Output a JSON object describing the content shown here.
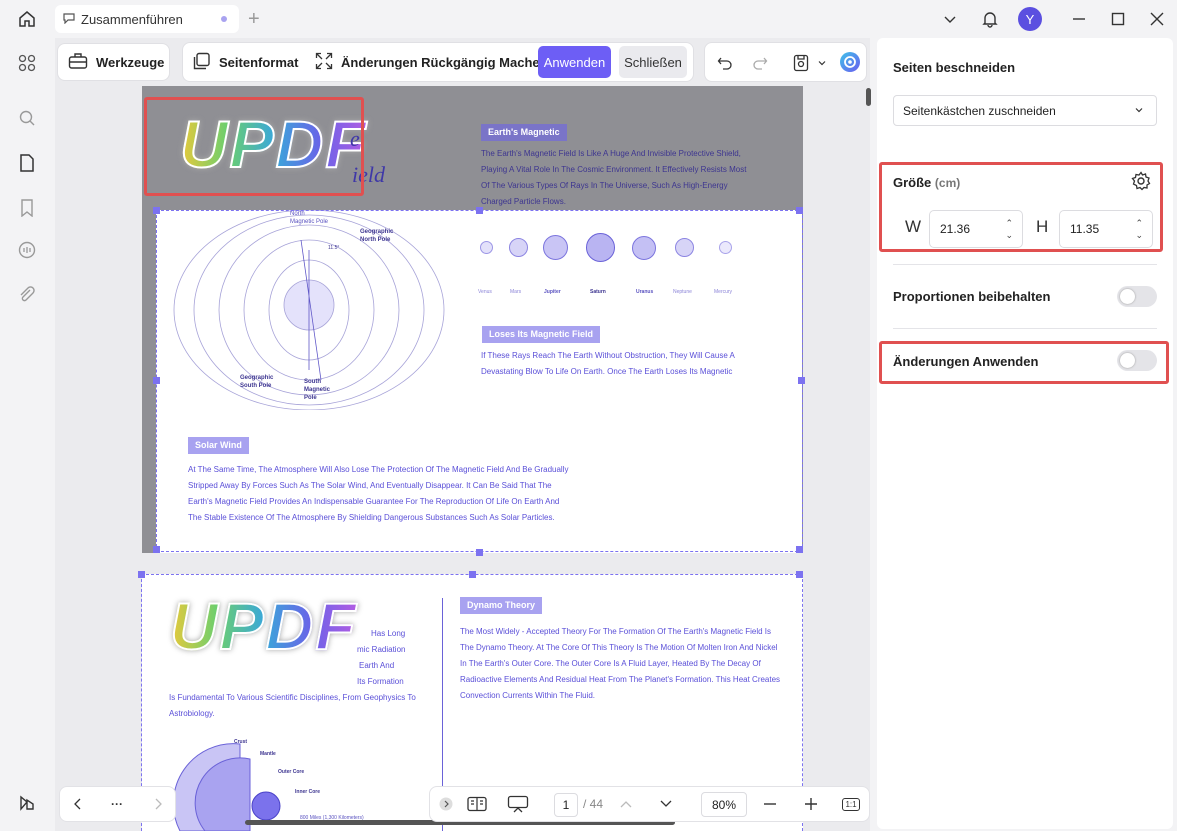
{
  "tab": {
    "title": "Zusammenführen"
  },
  "user": {
    "avatar_letter": "Y"
  },
  "toolbar": {
    "tools_label": "Werkzeuge",
    "page_format_label": "Seitenformat",
    "undo_changes_label": "Änderungen Rückgängig Machen",
    "apply_label": "Anwenden",
    "close_label": "Schließen"
  },
  "panel": {
    "title": "Seiten beschneiden",
    "crop_select_value": "Seitenkästchen zuschneiden",
    "size_label": "Größe",
    "size_unit": "(cm)",
    "w_label": "W",
    "w_value": "21.36",
    "h_label": "H",
    "h_value": "11.35",
    "keep_proportions_label": "Proportionen beibehalten",
    "keep_proportions_on": false,
    "apply_changes_label": "Änderungen Anwenden",
    "apply_changes_on": false
  },
  "bottom": {
    "more_label": "···",
    "page_current": "1",
    "page_total": "/ 44",
    "zoom": "80%",
    "fit_label": "1:1"
  },
  "doc": {
    "logo_text": "UPDF",
    "page1": {
      "title_partial_1": "e",
      "title_partial_2": "ield",
      "section1_label": "Earth's Magnetic",
      "section1_text": [
        "The Earth's Magnetic Field Is Like A Huge And Invisible Protective Shield,",
        "Playing A Vital Role In The Cosmic Environment. It Effectively Resists Most",
        "Of The Various Types Of Rays In The Universe, Such As High-Energy",
        "Charged Particle Flows."
      ],
      "diagram_labels": {
        "north_magnetic": "North Magnetic Pole",
        "geo_north": "Geographic North Pole",
        "geo_south": "Geographic South Pole",
        "south_magnetic": "South Magnetic Pole",
        "angle": "11.5°"
      },
      "planets": [
        "Venus",
        "Mars",
        "Jupiter",
        "Saturn",
        "Uranus",
        "Neptune",
        "Mercury"
      ],
      "section2_label": "Loses Its Magnetic Field",
      "section2_text": [
        "If These Rays Reach The Earth Without Obstruction, They Will Cause A",
        "Devastating Blow To Life On Earth. Once The Earth Loses Its Magnetic"
      ],
      "section3_label": "Solar Wind",
      "section3_text": [
        "At The Same Time, The Atmosphere Will Also Lose The Protection Of The Magnetic Field And Be Gradually",
        "Stripped Away By Forces Such As The Solar Wind, And Eventually Disappear. It Can Be Said That The",
        "Earth's Magnetic Field Provides An Indispensable Guarantee For The Reproduction Of Life On Earth And",
        "The Stable Existence Of The Atmosphere By Shielding Dangerous Substances Such As Solar Particles."
      ]
    },
    "page2": {
      "left_text": [
        "Has Long",
        "mic Radiation",
        "Earth And",
        "Its Formation",
        "Is Fundamental To Various Scientific Disciplines, From Geophysics To",
        "Astrobiology."
      ],
      "layers": [
        "Crust",
        "Mantle",
        "Outer Core",
        "Inner Core",
        "800 Miles (1,300 Kilometers)"
      ],
      "section_label": "Dynamo Theory",
      "section_text": [
        "The Most Widely - Accepted Theory For The Formation Of The Earth's Magnetic Field Is",
        "The Dynamo Theory. At The Core Of This Theory Is The Motion Of Molten Iron And Nickel",
        "In The Earth's Outer Core. The Outer Core Is A Fluid Layer, Heated By The Decay Of",
        "Radioactive Elements And Residual Heat From The Planet's Formation. This Heat Creates",
        "Convection Currents Within The Fluid."
      ]
    }
  }
}
